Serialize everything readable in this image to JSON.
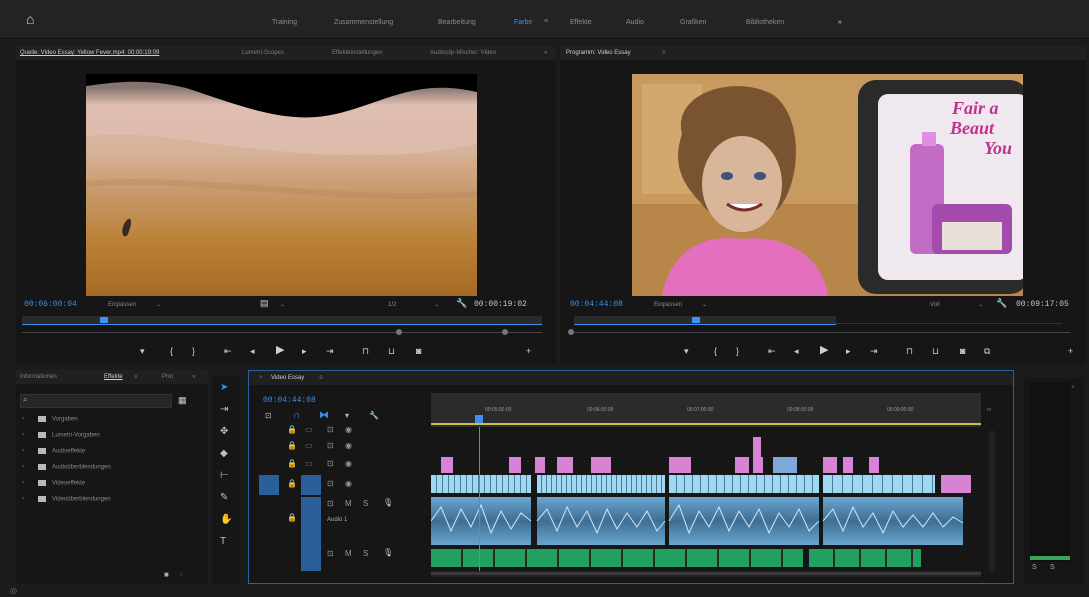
{
  "workspaces": [
    "Training",
    "Zusammenstellung",
    "Bearbeitung",
    "Farbe",
    "Effekte",
    "Audio",
    "Grafiken",
    "Bibliotheken"
  ],
  "active_workspace": "Farbe",
  "source_panel": {
    "tabs": [
      "Quelle: Video Essay: Yellow Fever.mp4: 00:00:19:09",
      "Lumetri-Scopes",
      "Effekteinstellungen",
      "Audioclip-Mischer: Video"
    ],
    "timecode_current": "00:06:00:04",
    "fit_label": "Einpassen",
    "resolution": "1/2",
    "timecode_duration": "00:00:19:02"
  },
  "program_panel": {
    "tab": "Programm: Video Essay",
    "timecode_current": "00:04:44:08",
    "fit_label": "Einpassen",
    "resolution": "Voll",
    "timecode_duration": "00:09:17:05",
    "overlay_text": [
      "Fair a",
      "Beaut",
      "You"
    ]
  },
  "effects_panel": {
    "tabs": [
      "Informationen",
      "Effekte",
      "Prot"
    ],
    "items": [
      "Vorgaben",
      "Lumetri-Vorgaben",
      "Audioeffekte",
      "Audioüberblendungen",
      "Videoeffekte",
      "Videoüberblendungen"
    ]
  },
  "timeline": {
    "tab": "Video Essay",
    "timecode": "00:04:44:08",
    "ruler_labels": [
      "00:05:00:00",
      "00:06:00:00",
      "00:07:00:00",
      "00:08:00:00",
      "00:09:00:00"
    ],
    "audio_track_label": "Audio 1"
  },
  "colors": {
    "accent": "#3d8ff0",
    "video_clip": "#9fd8f2",
    "pink_clip": "#d783d4",
    "audio_clip": "#5e9ec9",
    "green_clip": "#22a060"
  }
}
